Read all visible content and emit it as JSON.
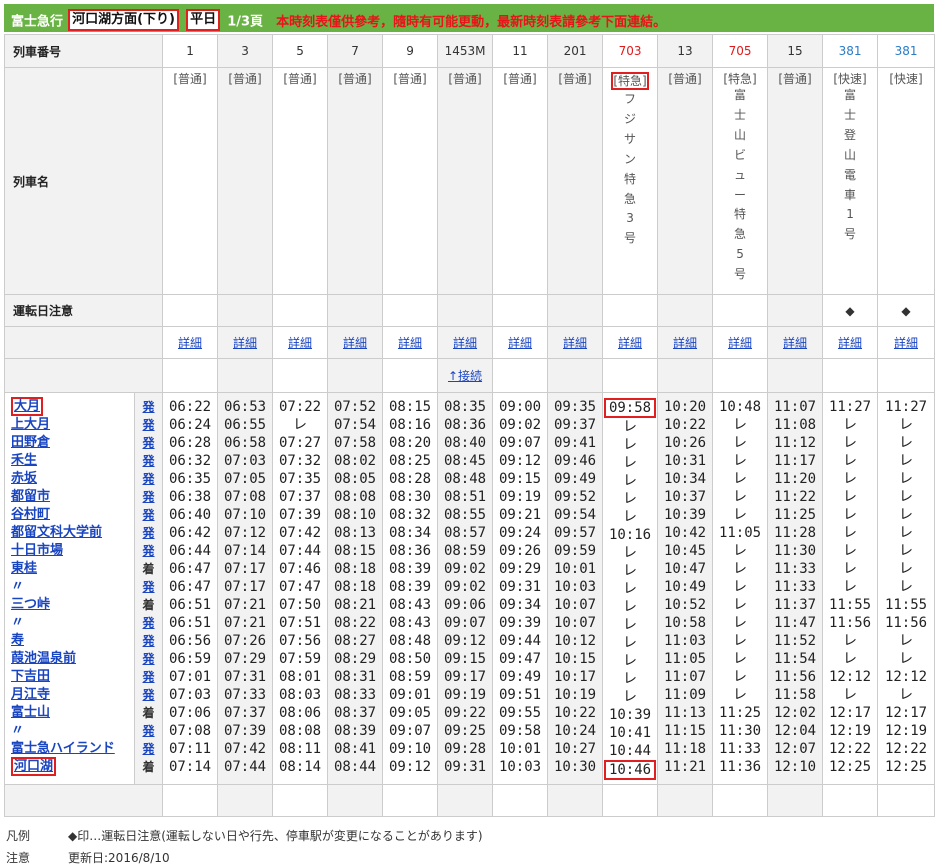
{
  "header": {
    "company": "富士急行",
    "direction": "河口湖方面(下り)",
    "daytype": "平日",
    "page": "1/3頁",
    "notice": "本時刻表僅供參考，隨時有可能更動，最新時刻表請參考下面連結。"
  },
  "labels": {
    "train_number": "列車番号",
    "train_name": "列車名",
    "operation_note": "運転日注意"
  },
  "colors": {
    "header_green": "#69b244",
    "highlight_red": "#e02020",
    "limited_express_red": "#e01b1b",
    "rapid_blue": "#2a7cc7"
  },
  "trains": [
    {
      "number": "1",
      "type": "[普通]",
      "name": "",
      "note": "",
      "detail": "詳細",
      "link": "",
      "color": "normal"
    },
    {
      "number": "3",
      "type": "[普通]",
      "name": "",
      "note": "",
      "detail": "詳細",
      "link": "",
      "color": "normal"
    },
    {
      "number": "5",
      "type": "[普通]",
      "name": "",
      "note": "",
      "detail": "詳細",
      "link": "",
      "color": "normal"
    },
    {
      "number": "7",
      "type": "[普通]",
      "name": "",
      "note": "",
      "detail": "詳細",
      "link": "",
      "color": "normal"
    },
    {
      "number": "9",
      "type": "[普通]",
      "name": "",
      "note": "",
      "detail": "詳細",
      "link": "",
      "color": "normal"
    },
    {
      "number": "1453M",
      "type": "[普通]",
      "name": "",
      "note": "",
      "detail": "詳細",
      "link": "↑接続",
      "color": "normal"
    },
    {
      "number": "11",
      "type": "[普通]",
      "name": "",
      "note": "",
      "detail": "詳細",
      "link": "",
      "color": "normal"
    },
    {
      "number": "201",
      "type": "[普通]",
      "name": "",
      "note": "",
      "detail": "詳細",
      "link": "",
      "color": "normal"
    },
    {
      "number": "703",
      "type": "[特急]",
      "name": "フジサン特急3号",
      "note": "",
      "detail": "詳細",
      "link": "",
      "color": "red"
    },
    {
      "number": "13",
      "type": "[普通]",
      "name": "",
      "note": "",
      "detail": "詳細",
      "link": "",
      "color": "normal"
    },
    {
      "number": "705",
      "type": "[特急]",
      "name": "富士山ビュー特急5号",
      "note": "",
      "detail": "詳細",
      "link": "",
      "color": "red"
    },
    {
      "number": "15",
      "type": "[普通]",
      "name": "",
      "note": "",
      "detail": "詳細",
      "link": "",
      "color": "normal"
    },
    {
      "number": "381",
      "type": "[快速]",
      "name": "富士登山電車1号",
      "note": "◆",
      "detail": "詳細",
      "link": "",
      "color": "blue"
    },
    {
      "number": "381",
      "type": "[快速]",
      "name": "",
      "note": "◆",
      "detail": "詳細",
      "link": "",
      "color": "blue"
    }
  ],
  "stations": [
    {
      "name": "大月",
      "mark": "発",
      "link": true
    },
    {
      "name": "上大月",
      "mark": "発",
      "link": true
    },
    {
      "name": "田野倉",
      "mark": "発",
      "link": true
    },
    {
      "name": "禾生",
      "mark": "発",
      "link": true
    },
    {
      "name": "赤坂",
      "mark": "発",
      "link": true
    },
    {
      "name": "都留市",
      "mark": "発",
      "link": true
    },
    {
      "name": "谷村町",
      "mark": "発",
      "link": true
    },
    {
      "name": "都留文科大学前",
      "mark": "発",
      "link": true
    },
    {
      "name": "十日市場",
      "mark": "発",
      "link": true
    },
    {
      "name": "東桂",
      "mark": "着",
      "link": true
    },
    {
      "name": "〃",
      "mark": "発",
      "link": false
    },
    {
      "name": "三つ峠",
      "mark": "着",
      "link": true
    },
    {
      "name": "〃",
      "mark": "発",
      "link": false
    },
    {
      "name": "寿",
      "mark": "発",
      "link": true
    },
    {
      "name": "葭池温泉前",
      "mark": "発",
      "link": true
    },
    {
      "name": "下吉田",
      "mark": "発",
      "link": true
    },
    {
      "name": "月江寺",
      "mark": "発",
      "link": true
    },
    {
      "name": "富士山",
      "mark": "着",
      "link": true
    },
    {
      "name": "〃",
      "mark": "発",
      "link": false
    },
    {
      "name": "富士急ハイランド",
      "mark": "発",
      "link": true
    },
    {
      "name": "河口湖",
      "mark": "着",
      "link": true
    }
  ],
  "times": [
    [
      "06:22",
      "06:24",
      "06:28",
      "06:32",
      "06:35",
      "06:38",
      "06:40",
      "06:42",
      "06:44",
      "06:47",
      "06:47",
      "06:51",
      "06:51",
      "06:56",
      "06:59",
      "07:01",
      "07:03",
      "07:06",
      "07:08",
      "07:11",
      "07:14"
    ],
    [
      "06:53",
      "06:55",
      "06:58",
      "07:03",
      "07:05",
      "07:08",
      "07:10",
      "07:12",
      "07:14",
      "07:17",
      "07:17",
      "07:21",
      "07:21",
      "07:26",
      "07:29",
      "07:31",
      "07:33",
      "07:37",
      "07:39",
      "07:42",
      "07:44"
    ],
    [
      "07:22",
      "レ",
      "07:27",
      "07:32",
      "07:35",
      "07:37",
      "07:39",
      "07:42",
      "07:44",
      "07:46",
      "07:47",
      "07:50",
      "07:51",
      "07:56",
      "07:59",
      "08:01",
      "08:03",
      "08:06",
      "08:08",
      "08:11",
      "08:14"
    ],
    [
      "07:52",
      "07:54",
      "07:58",
      "08:02",
      "08:05",
      "08:08",
      "08:10",
      "08:13",
      "08:15",
      "08:18",
      "08:18",
      "08:21",
      "08:22",
      "08:27",
      "08:29",
      "08:31",
      "08:33",
      "08:37",
      "08:39",
      "08:41",
      "08:44"
    ],
    [
      "08:15",
      "08:16",
      "08:20",
      "08:25",
      "08:28",
      "08:30",
      "08:32",
      "08:34",
      "08:36",
      "08:39",
      "08:39",
      "08:43",
      "08:43",
      "08:48",
      "08:50",
      "08:59",
      "09:01",
      "09:05",
      "09:07",
      "09:10",
      "09:12"
    ],
    [
      "08:35",
      "08:36",
      "08:40",
      "08:45",
      "08:48",
      "08:51",
      "08:55",
      "08:57",
      "08:59",
      "09:02",
      "09:02",
      "09:06",
      "09:07",
      "09:12",
      "09:15",
      "09:17",
      "09:19",
      "09:22",
      "09:25",
      "09:28",
      "09:31"
    ],
    [
      "09:00",
      "09:02",
      "09:07",
      "09:12",
      "09:15",
      "09:19",
      "09:21",
      "09:24",
      "09:26",
      "09:29",
      "09:31",
      "09:34",
      "09:39",
      "09:44",
      "09:47",
      "09:49",
      "09:51",
      "09:55",
      "09:58",
      "10:01",
      "10:03"
    ],
    [
      "09:35",
      "09:37",
      "09:41",
      "09:46",
      "09:49",
      "09:52",
      "09:54",
      "09:57",
      "09:59",
      "10:01",
      "10:03",
      "10:07",
      "10:07",
      "10:12",
      "10:15",
      "10:17",
      "10:19",
      "10:22",
      "10:24",
      "10:27",
      "10:30"
    ],
    [
      "09:58",
      "レ",
      "レ",
      "レ",
      "レ",
      "レ",
      "レ",
      "10:16",
      "レ",
      "レ",
      "レ",
      "レ",
      "レ",
      "レ",
      "レ",
      "レ",
      "レ",
      "10:39",
      "10:41",
      "10:44",
      "10:46"
    ],
    [
      "10:20",
      "10:22",
      "10:26",
      "10:31",
      "10:34",
      "10:37",
      "10:39",
      "10:42",
      "10:45",
      "10:47",
      "10:49",
      "10:52",
      "10:58",
      "11:03",
      "11:05",
      "11:07",
      "11:09",
      "11:13",
      "11:15",
      "11:18",
      "11:21"
    ],
    [
      "10:48",
      "レ",
      "レ",
      "レ",
      "レ",
      "レ",
      "レ",
      "11:05",
      "レ",
      "レ",
      "レ",
      "レ",
      "レ",
      "レ",
      "レ",
      "レ",
      "レ",
      "11:25",
      "11:30",
      "11:33",
      "11:36"
    ],
    [
      "11:07",
      "11:08",
      "11:12",
      "11:17",
      "11:20",
      "11:22",
      "11:25",
      "11:28",
      "11:30",
      "11:33",
      "11:33",
      "11:37",
      "11:47",
      "11:52",
      "11:54",
      "11:56",
      "11:58",
      "12:02",
      "12:04",
      "12:07",
      "12:10"
    ],
    [
      "11:27",
      "レ",
      "レ",
      "レ",
      "レ",
      "レ",
      "レ",
      "レ",
      "レ",
      "レ",
      "レ",
      "11:55",
      "11:56",
      "レ",
      "レ",
      "12:12",
      "レ",
      "12:17",
      "12:19",
      "12:22",
      "12:25"
    ],
    [
      "11:27",
      "レ",
      "レ",
      "レ",
      "レ",
      "レ",
      "レ",
      "レ",
      "レ",
      "レ",
      "レ",
      "11:55",
      "11:56",
      "レ",
      "レ",
      "12:12",
      "レ",
      "12:17",
      "12:19",
      "12:22",
      "12:25"
    ]
  ],
  "legend": {
    "label": "凡例",
    "text": "◆印…運転日注意(運転しない日や行先、停車駅が変更になることがあります)"
  },
  "note": {
    "label": "注意",
    "text": "更新日:2016/8/10"
  }
}
